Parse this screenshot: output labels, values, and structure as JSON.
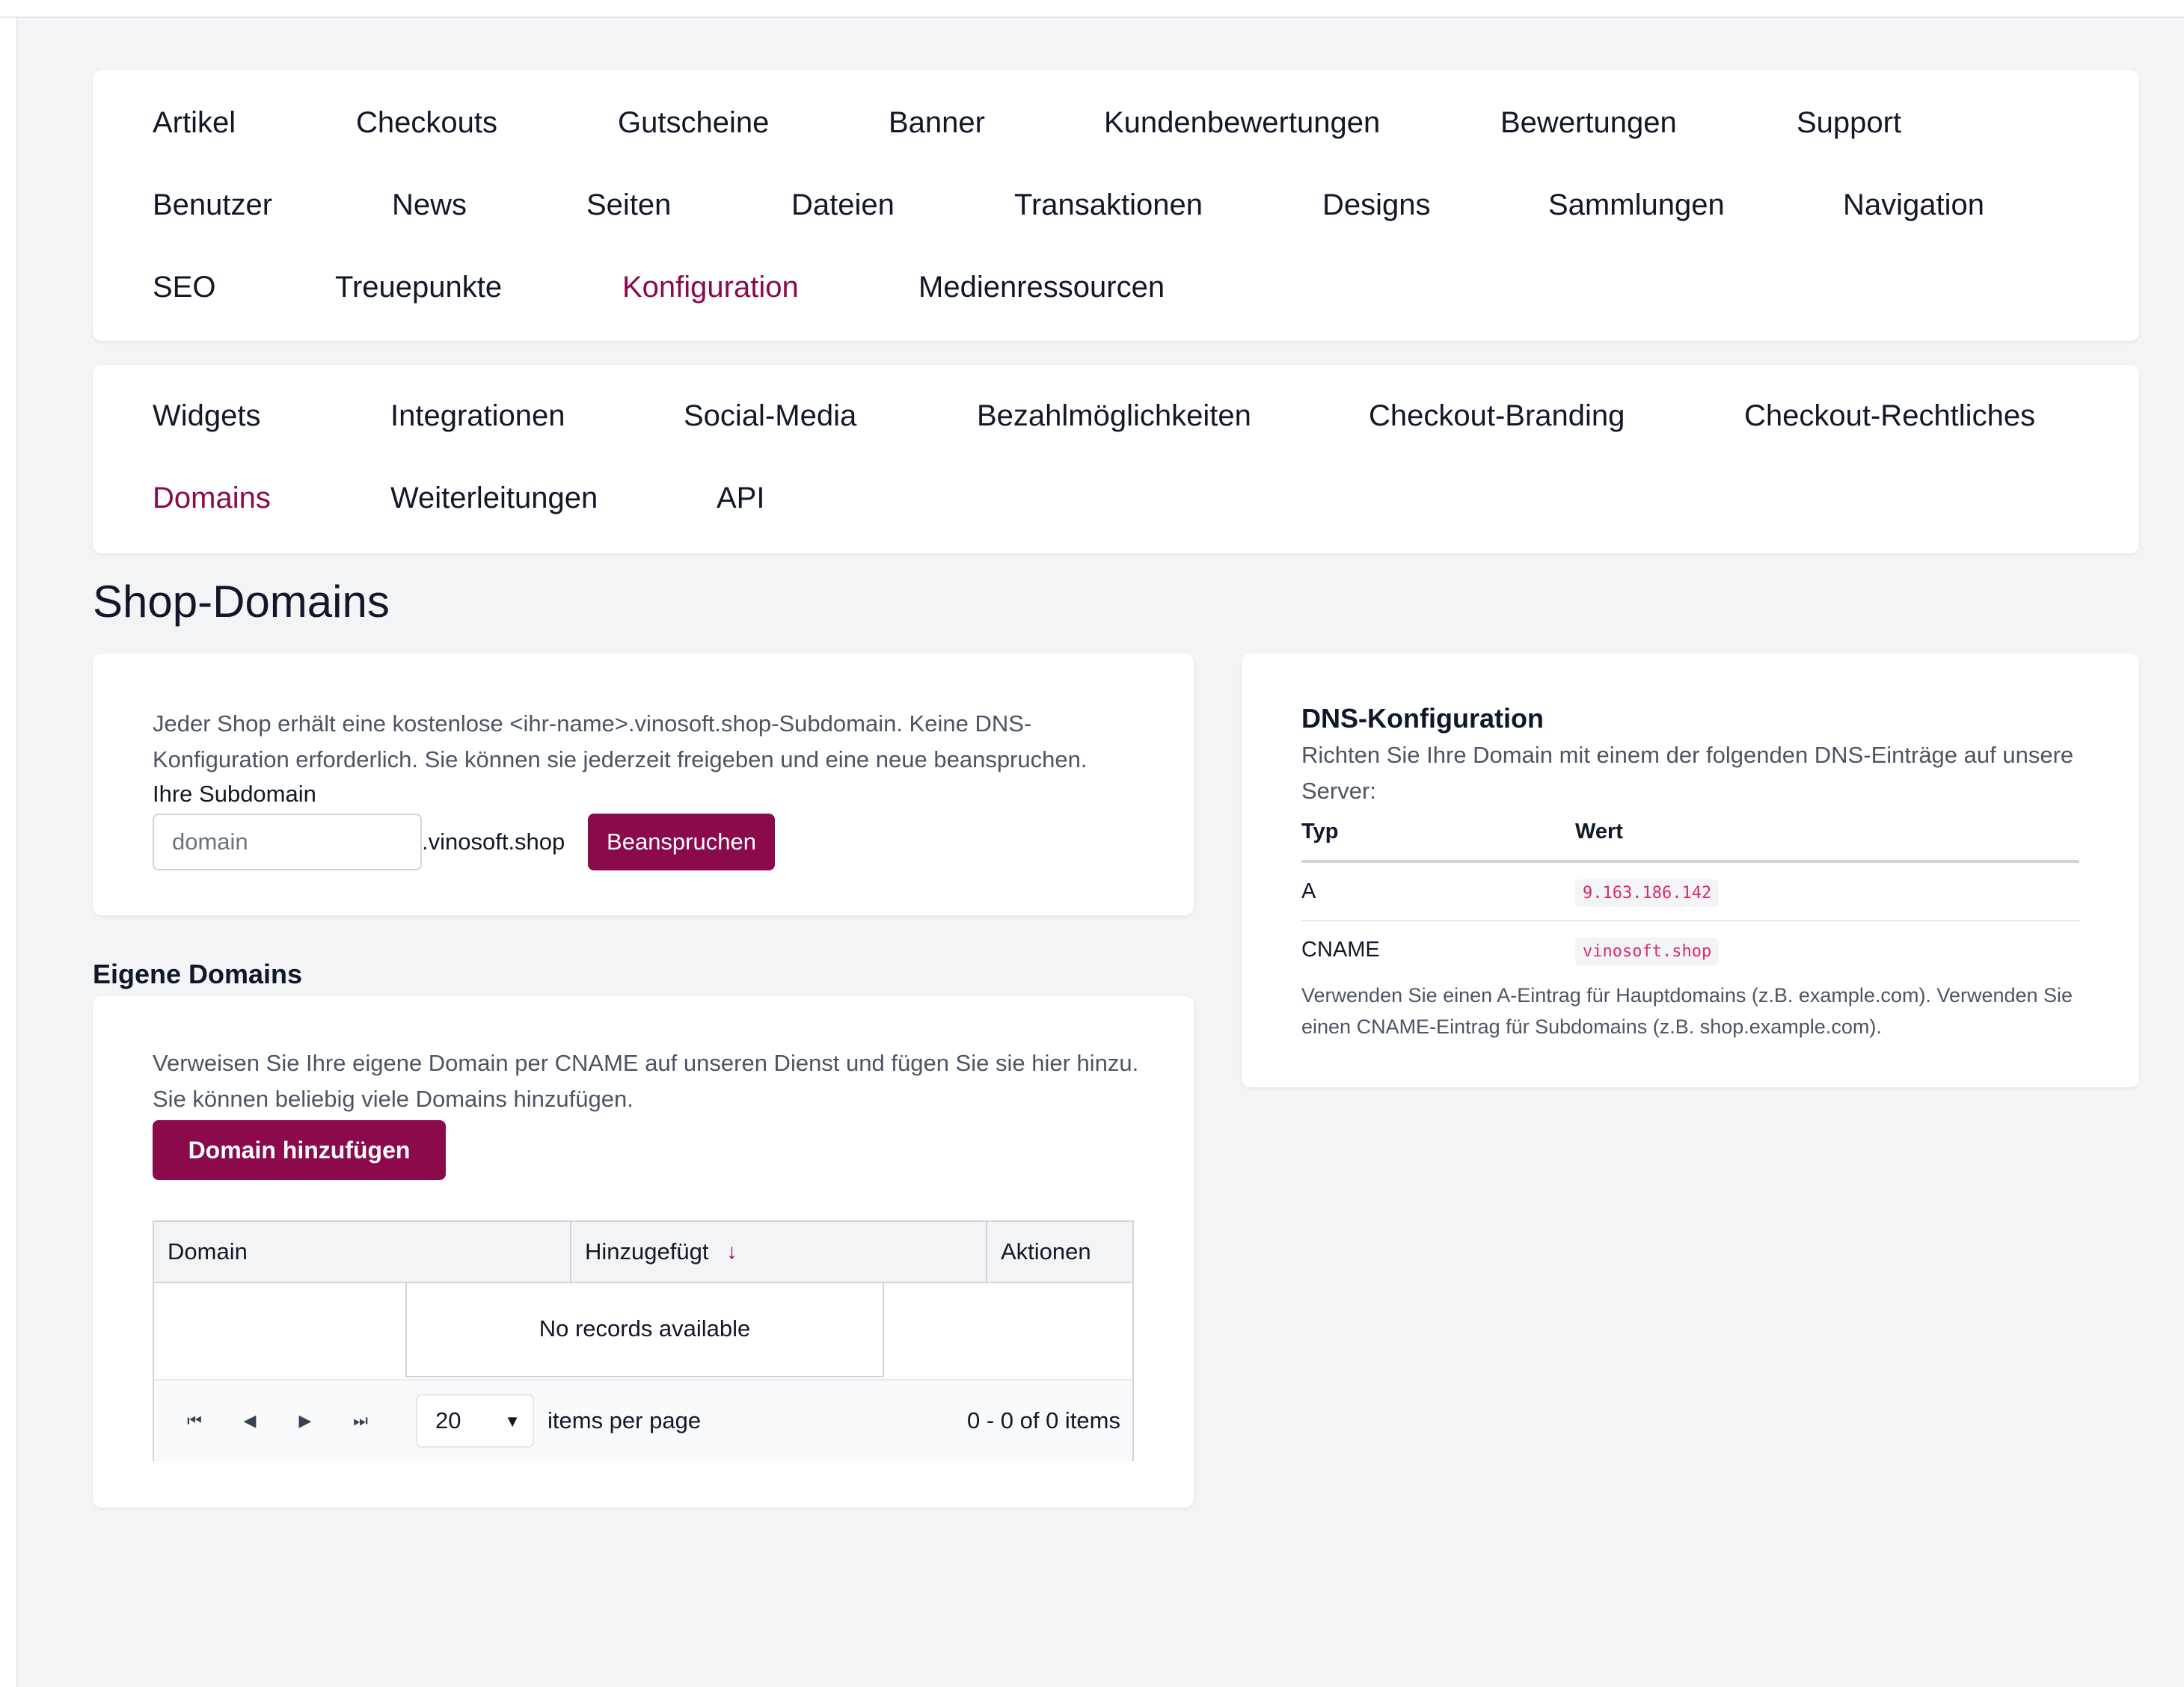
{
  "main_nav": {
    "rows": [
      [
        "Artikel",
        "Checkouts",
        "Gutscheine",
        "Banner",
        "Kundenbewertungen",
        "Bewertungen",
        "Support"
      ],
      [
        "Benutzer",
        "News",
        "Seiten",
        "Dateien",
        "Transaktionen",
        "Designs",
        "Sammlungen",
        "Navigation"
      ],
      [
        "SEO",
        "Treuepunkte",
        "Konfiguration",
        "Medienressourcen"
      ]
    ],
    "active": "Konfiguration"
  },
  "sub_nav": {
    "rows": [
      [
        "Widgets",
        "Integrationen",
        "Social-Media",
        "Bezahlmöglichkeiten",
        "Checkout-Branding",
        "Checkout-Rechtliches"
      ],
      [
        "Domains",
        "Weiterleitungen",
        "API"
      ]
    ],
    "active": "Domains"
  },
  "page_title": "Shop-Domains",
  "subdomain": {
    "description": "Jeder Shop erhält eine kostenlose <ihr-name>.vinosoft.shop-Subdomain. Keine DNS-Konfiguration erforderlich. Sie können sie jederzeit freigeben und eine neue beanspruchen.",
    "label": "Ihre Subdomain",
    "placeholder": "domain",
    "suffix": ".vinosoft.shop",
    "claim_button": "Beanspruchen"
  },
  "own_domains": {
    "title": "Eigene Domains",
    "description": "Verweisen Sie Ihre eigene Domain per CNAME auf unseren Dienst und fügen Sie sie hier hinzu. Sie können beliebig viele Domains hinzufügen.",
    "add_button": "Domain hinzufügen",
    "grid": {
      "columns": [
        "Domain",
        "Hinzugefügt",
        "Aktionen"
      ],
      "sort_icon": "arrow-down-icon",
      "empty_text": "No records available",
      "page_size": "20",
      "items_per_page_label": "items per page",
      "summary": "0 - 0 of 0 items"
    }
  },
  "dns": {
    "title": "DNS-Konfiguration",
    "description": "Richten Sie Ihre Domain mit einem der folgenden DNS-Einträge auf unsere Server:",
    "headers": [
      "Typ",
      "Wert"
    ],
    "records": [
      {
        "type": "A",
        "value": "9.163.186.142"
      },
      {
        "type": "CNAME",
        "value": "vinosoft.shop"
      }
    ],
    "note": "Verwenden Sie einen A-Eintrag für Hauptdomains (z.B. example.com). Verwenden Sie einen CNAME-Eintrag für Subdomains (z.B. shop.example.com)."
  },
  "colors": {
    "accent": "#8a0a4b",
    "background": "#f3f4f6",
    "card": "#ffffff",
    "code_text": "#db2777"
  }
}
